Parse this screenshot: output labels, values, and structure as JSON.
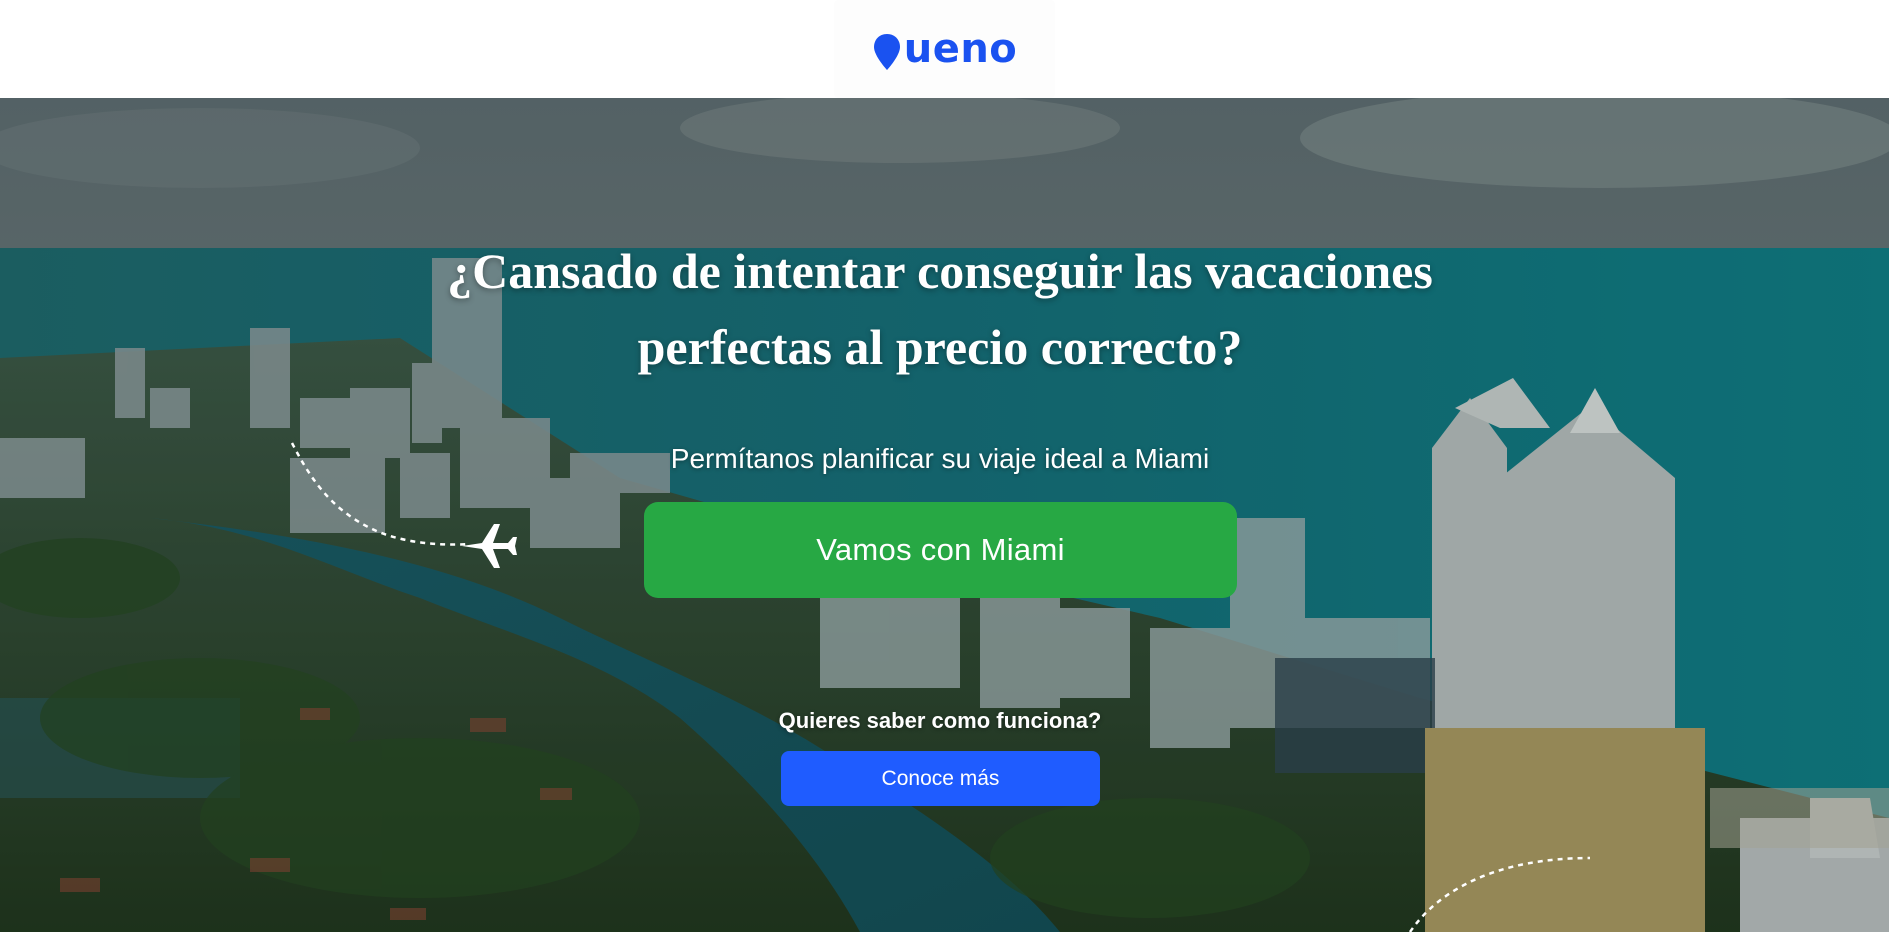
{
  "header": {
    "logo_text": "ueno",
    "logo_icon": "location-pin-icon",
    "brand_color": "#1a52f0"
  },
  "hero": {
    "headline_line1": "¿Cansado de intentar conseguir las vacaciones",
    "headline_line2": "perfectas al precio correcto?",
    "subtitle": "Permítanos planificar su viaje ideal a Miami",
    "primary_button_label": "Vamos con Miami",
    "primary_button_color": "#27a844",
    "question": "Quieres saber como funciona?",
    "secondary_button_label": "Conoce más",
    "secondary_button_color": "#1f5cff",
    "decor_icon": "airplane-icon"
  }
}
